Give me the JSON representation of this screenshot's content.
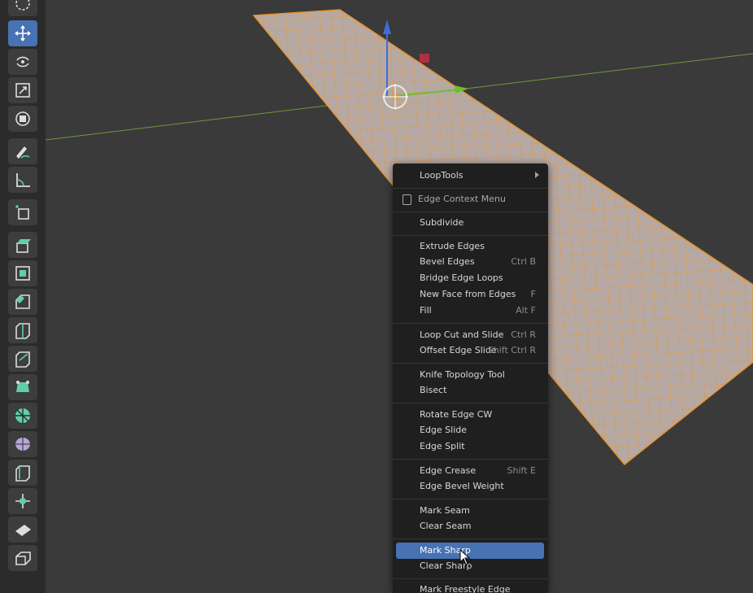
{
  "menu": {
    "loop_tools": "LoopTools",
    "header": "Edge Context Menu",
    "subdivide": "Subdivide",
    "extrude_edges": "Extrude Edges",
    "bevel_edges": "Bevel Edges",
    "bevel_edges_sc": "Ctrl B",
    "bridge_edge_loops": "Bridge Edge Loops",
    "new_face_from_edges": "New Face from Edges",
    "new_face_from_edges_sc": "F",
    "fill": "Fill",
    "fill_sc": "Alt F",
    "loop_cut_and_slide": "Loop Cut and Slide",
    "loop_cut_and_slide_sc": "Ctrl R",
    "offset_edge_slide": "Offset Edge Slide",
    "offset_edge_slide_sc": "Shift Ctrl R",
    "knife_topology_tool": "Knife Topology Tool",
    "bisect": "Bisect",
    "rotate_edge_cw": "Rotate Edge CW",
    "edge_slide": "Edge Slide",
    "edge_split": "Edge Split",
    "edge_crease": "Edge Crease",
    "edge_crease_sc": "Shift E",
    "edge_bevel_weight": "Edge Bevel Weight",
    "mark_seam": "Mark Seam",
    "clear_seam": "Clear Seam",
    "mark_sharp": "Mark Sharp",
    "clear_sharp": "Clear Sharp",
    "mark_freestyle_edge": "Mark Freestyle Edge"
  },
  "toolbar": {
    "icons": [
      "select-circle-icon",
      "move-icon",
      "rotate-icon",
      "scale-icon",
      "transform-icon",
      "annotate-icon",
      "measure-icon",
      "add-cube-icon",
      "extrude-region-icon",
      "inset-faces-icon",
      "bevel-icon",
      "loop-cut-icon",
      "knife-icon",
      "poly-build-icon",
      "spin-icon",
      "smooth-icon",
      "edge-slide-icon",
      "shrink-fatten-icon",
      "shear-icon",
      "rip-region-icon"
    ],
    "active": "move-icon"
  },
  "colors": {
    "accent": "#4772b3",
    "selection": "#e8932f",
    "x_axis": "#8b3a3a",
    "y_axis": "#6e9a3a",
    "z_axis": "#3a6fd8"
  }
}
